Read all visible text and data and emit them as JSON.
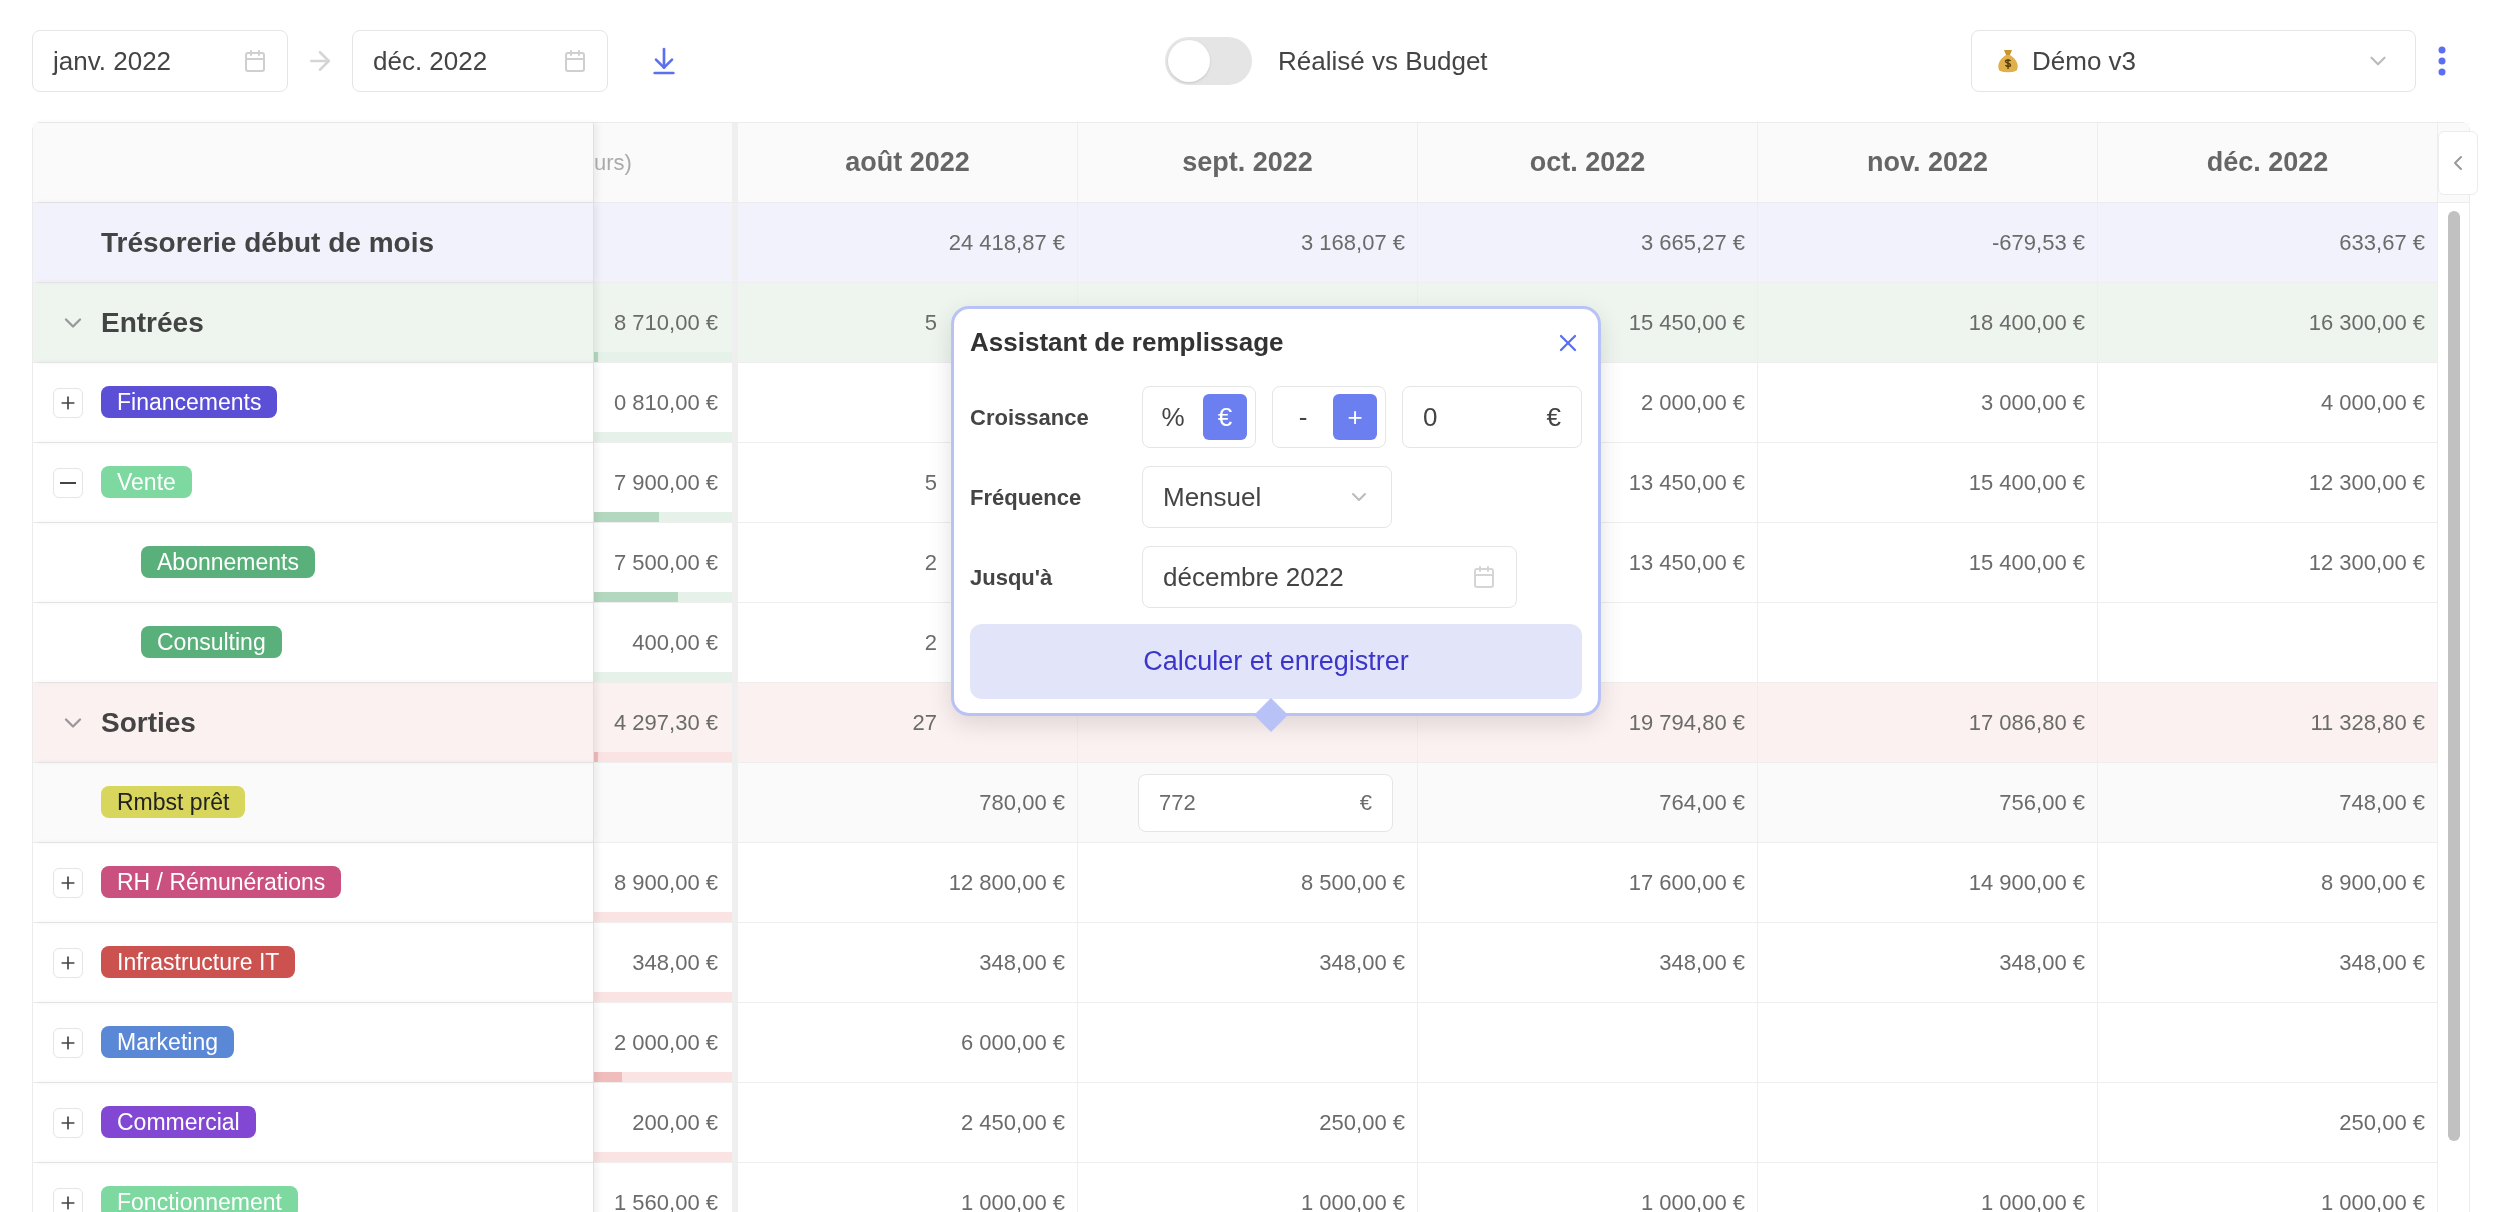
{
  "toolbar": {
    "start_date": "janv. 2022",
    "end_date": "déc. 2022",
    "toggle": {
      "label": "Réalisé vs Budget",
      "on": false
    },
    "scenario": "Démo v3"
  },
  "table": {
    "columns": [
      "urs)",
      "août 2022",
      "sept. 2022",
      "oct. 2022",
      "nov. 2022",
      "déc. 2022"
    ],
    "rows": [
      {
        "kind": "balance",
        "label": "Trésorerie début de mois",
        "cells": [
          null,
          "24 418,87 €",
          "3 168,07 €",
          "3 665,27 €",
          "-679,53 €",
          "633,67 €"
        ]
      },
      {
        "kind": "inflows",
        "label": "Entrées",
        "expanded": true,
        "level": 0.03,
        "cells": [
          "8 710,00 €",
          "5",
          null,
          "15 450,00 €",
          "18 400,00 €",
          "16 300,00 €"
        ]
      },
      {
        "kind": "category",
        "label": "Financements",
        "color": "#5b4fd6",
        "expanded": false,
        "cells": [
          "0 810,00 €",
          null,
          null,
          "2 000,00 €",
          "3 000,00 €",
          "4 000,00 €"
        ]
      },
      {
        "kind": "category",
        "label": "Vente",
        "color": "#7ed9a0",
        "expanded": true,
        "level": 0.47,
        "cells": [
          "7 900,00 €",
          "5",
          null,
          "13 450,00 €",
          "15 400,00 €",
          "12 300,00 €"
        ]
      },
      {
        "kind": "subcategory",
        "label": "Abonnements",
        "color": "#5ab07a",
        "level": 0.61,
        "cells": [
          "7 500,00 €",
          "2",
          null,
          "13 450,00 €",
          "15 400,00 €",
          "12 300,00 €"
        ]
      },
      {
        "kind": "subcategory",
        "label": "Consulting",
        "color": "#5ab07a",
        "cells": [
          "400,00 €",
          "2",
          null,
          null,
          null,
          null
        ]
      },
      {
        "kind": "outflows",
        "label": "Sorties",
        "expanded": true,
        "level": 0.03,
        "cells": [
          "4 297,30 €",
          "27",
          null,
          "19 794,80 €",
          "17 086,80 €",
          "11 328,80 €"
        ]
      },
      {
        "kind": "tag",
        "label": "Rmbst prêt",
        "color": "#d8d65c",
        "cells": [
          null,
          "780,00 €",
          {
            "kind": "input",
            "value": "772",
            "unit": "€"
          },
          "764,00 €",
          "756,00 €",
          "748,00 €"
        ]
      },
      {
        "kind": "category",
        "label": "RH / Rémunérations",
        "color": "#c9507f",
        "expanded": false,
        "cells": [
          "8 900,00 €",
          "12 800,00 €",
          "8 500,00 €",
          "17 600,00 €",
          "14 900,00 €",
          "8 900,00 €"
        ]
      },
      {
        "kind": "category",
        "label": "Infrastructure IT",
        "color": "#cc5250",
        "expanded": false,
        "cells": [
          "348,00 €",
          "348,00 €",
          "348,00 €",
          "348,00 €",
          "348,00 €",
          "348,00 €"
        ]
      },
      {
        "kind": "category",
        "label": "Marketing",
        "color": "#5a87d6",
        "expanded": false,
        "level": 0.2,
        "cells": [
          "2 000,00 €",
          "6 000,00 €",
          null,
          null,
          null,
          null
        ]
      },
      {
        "kind": "category",
        "label": "Commercial",
        "color": "#8248d4",
        "expanded": false,
        "cells": [
          "200,00 €",
          "2 450,00 €",
          "250,00 €",
          null,
          null,
          "250,00 €"
        ]
      },
      {
        "kind": "category",
        "label": "Fonctionnement",
        "color": "#7ed9a0",
        "expanded": false,
        "cells": [
          "1 560,00 €",
          "1 000,00 €",
          "1 000,00 €",
          "1 000,00 €",
          "1 000,00 €",
          "1 000,00 €"
        ]
      }
    ]
  },
  "fill_assistant": {
    "title": "Assistant de remplissage",
    "growth_label": "Croissance",
    "unit_options": [
      {
        "label": "%",
        "selected": false
      },
      {
        "label": "€",
        "selected": true
      }
    ],
    "sign_options": [
      {
        "label": "-",
        "selected": false
      },
      {
        "label": "+",
        "selected": true
      }
    ],
    "growth_value": "0",
    "growth_suffix": "€",
    "frequency_label": "Fréquence",
    "frequency": "Mensuel",
    "until_label": "Jusqu'à",
    "until": "décembre 2022",
    "submit": "Calculer et enregistrer"
  }
}
